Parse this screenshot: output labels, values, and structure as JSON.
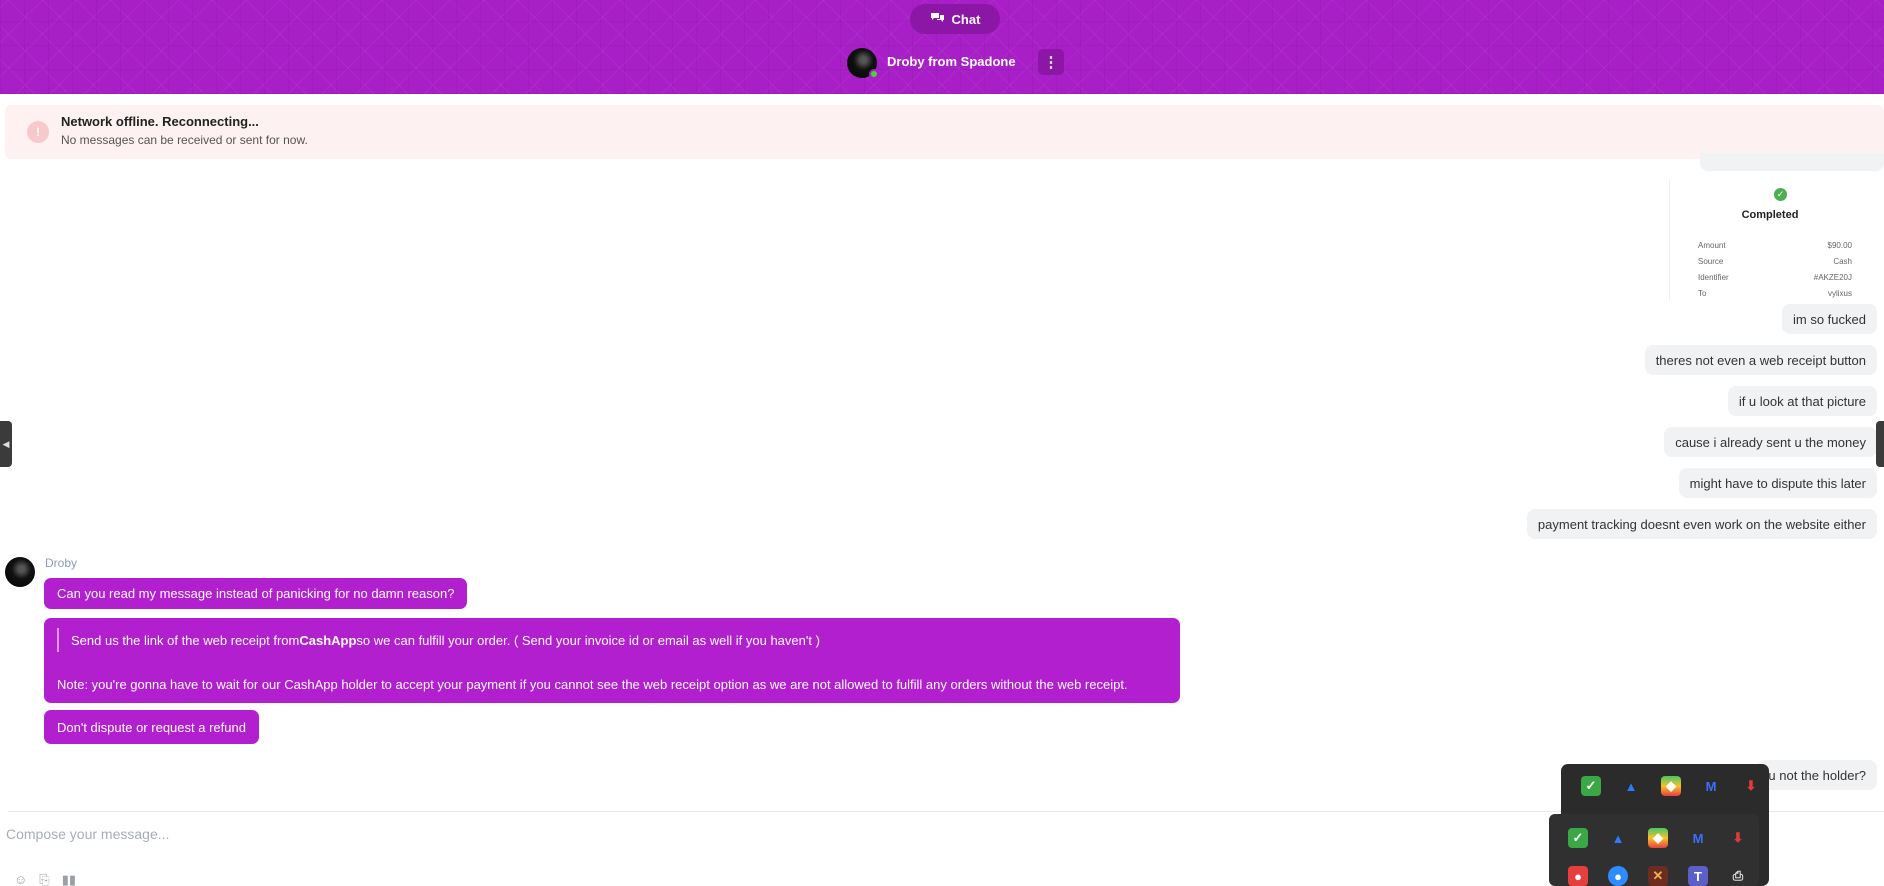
{
  "header": {
    "chat_label": "Chat",
    "agent_name": "Droby from Spadone"
  },
  "banner": {
    "title": "Network offline. Reconnecting...",
    "text": "No messages can be received or sent for now."
  },
  "receipt": {
    "status": "Completed",
    "rows": [
      {
        "label": "Amount",
        "value": "$90.00"
      },
      {
        "label": "Source",
        "value": "Cash"
      },
      {
        "label": "Identifier",
        "value": "#AKZE20J"
      },
      {
        "label": "To",
        "value": "vylixus"
      }
    ]
  },
  "outgoing": [
    "im so fucked",
    "theres not even a web receipt button",
    "if u look at that picture",
    "cause i already sent u the money",
    "might have to dispute this later",
    "payment tracking doesnt even work on the website either",
    "u not the holder?"
  ],
  "droby": {
    "name": "Droby",
    "msg1": "Can you read my message instead of panicking for no damn reason?",
    "quote_pre": "Send us the link of the web receipt from ",
    "quote_bold": "CashApp",
    "quote_post": " so we can fulfill your order. ( Send your invoice id or email as well if you haven't )",
    "note": "Note: you're gonna have to wait for our CashApp holder to accept your payment if you cannot see the web receipt option as we are not allowed to fulfill any orders without the web receipt.",
    "msg3": "Don't dispute or request a refund"
  },
  "composer": {
    "placeholder": "Compose your message..."
  },
  "colors": {
    "brand": "#a81fc7",
    "incoming_bubble": "#b11fcf",
    "outgoing_bubble": "#f1f2f4",
    "banner_bg": "#fef1f1",
    "online": "#4cd137"
  },
  "icons": {
    "chat_pill": "chat-bubbles-icon",
    "menu": "kebab-menu-icon",
    "banner": "alert-icon",
    "receipt": "check-circle-icon",
    "composer_tools": [
      "emoji-icon",
      "attachment-icon",
      "voice-icon"
    ],
    "tray_row1": [
      "shield-check-icon",
      "blue-app-icon",
      "bluestacks-icon",
      "malwarebytes-icon",
      "download-icon"
    ],
    "tray_row2": [
      "shield-check-icon",
      "blue-app-icon",
      "bluestacks-icon",
      "malwarebytes-icon",
      "download-icon"
    ],
    "tray_row3": [
      "red-app-icon",
      "browser-icon",
      "game-icon",
      "teams-icon",
      "usb-icon"
    ]
  }
}
